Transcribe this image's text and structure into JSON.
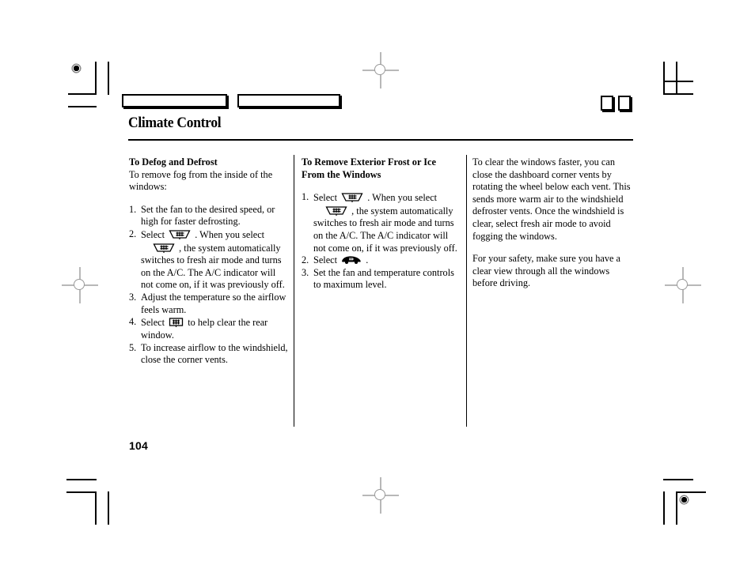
{
  "document": {
    "title": "Climate Control",
    "page_number": "104"
  },
  "icons": {
    "front_defroster": "windshield-defroster-icon",
    "rear_defroster": "rear-window-defroster-icon",
    "fresh_air": "fresh-air-mode-car-icon"
  },
  "columns": {
    "left": {
      "subhead": "To Defog and Defrost",
      "intro": "To remove fog from the inside of the windows:",
      "steps": [
        {
          "num": "1.",
          "text": "Set the fan to the desired speed, or high for faster defrosting."
        },
        {
          "num": "2.",
          "pre": "Select",
          "mid": ". When you select",
          "post": ", the system automatically switches to fresh air mode and turns on the A/C. The A/C indicator will not come on, if it was previously off."
        },
        {
          "num": "3.",
          "text": "Adjust the temperature so the airflow feels warm."
        },
        {
          "num": "4.",
          "pre": "Select",
          "post": "to help clear the rear window."
        },
        {
          "num": "5.",
          "text": "To increase airflow to the windshield, close the corner vents."
        }
      ]
    },
    "middle": {
      "subhead": "To Remove Exterior Frost or Ice From the Windows",
      "steps": [
        {
          "num": "1.",
          "pre": "Select",
          "mid": ". When you select",
          "post": ", the system automatically switches to fresh air mode and turns on the A/C. The A/C indicator will not come on, if it was previously off."
        },
        {
          "num": "2.",
          "pre": "Select",
          "post": "."
        },
        {
          "num": "3.",
          "text": "Set the fan and temperature controls to maximum level."
        }
      ]
    },
    "right": {
      "para1": "To clear the windows faster, you can close the dashboard corner vents by rotating the wheel below each vent. This sends more warm air to the windshield defroster vents. Once the windshield is clear, select fresh air mode to avoid fogging the windows.",
      "para2": "For your safety, make sure you have a clear view through all the windows before driving."
    }
  }
}
